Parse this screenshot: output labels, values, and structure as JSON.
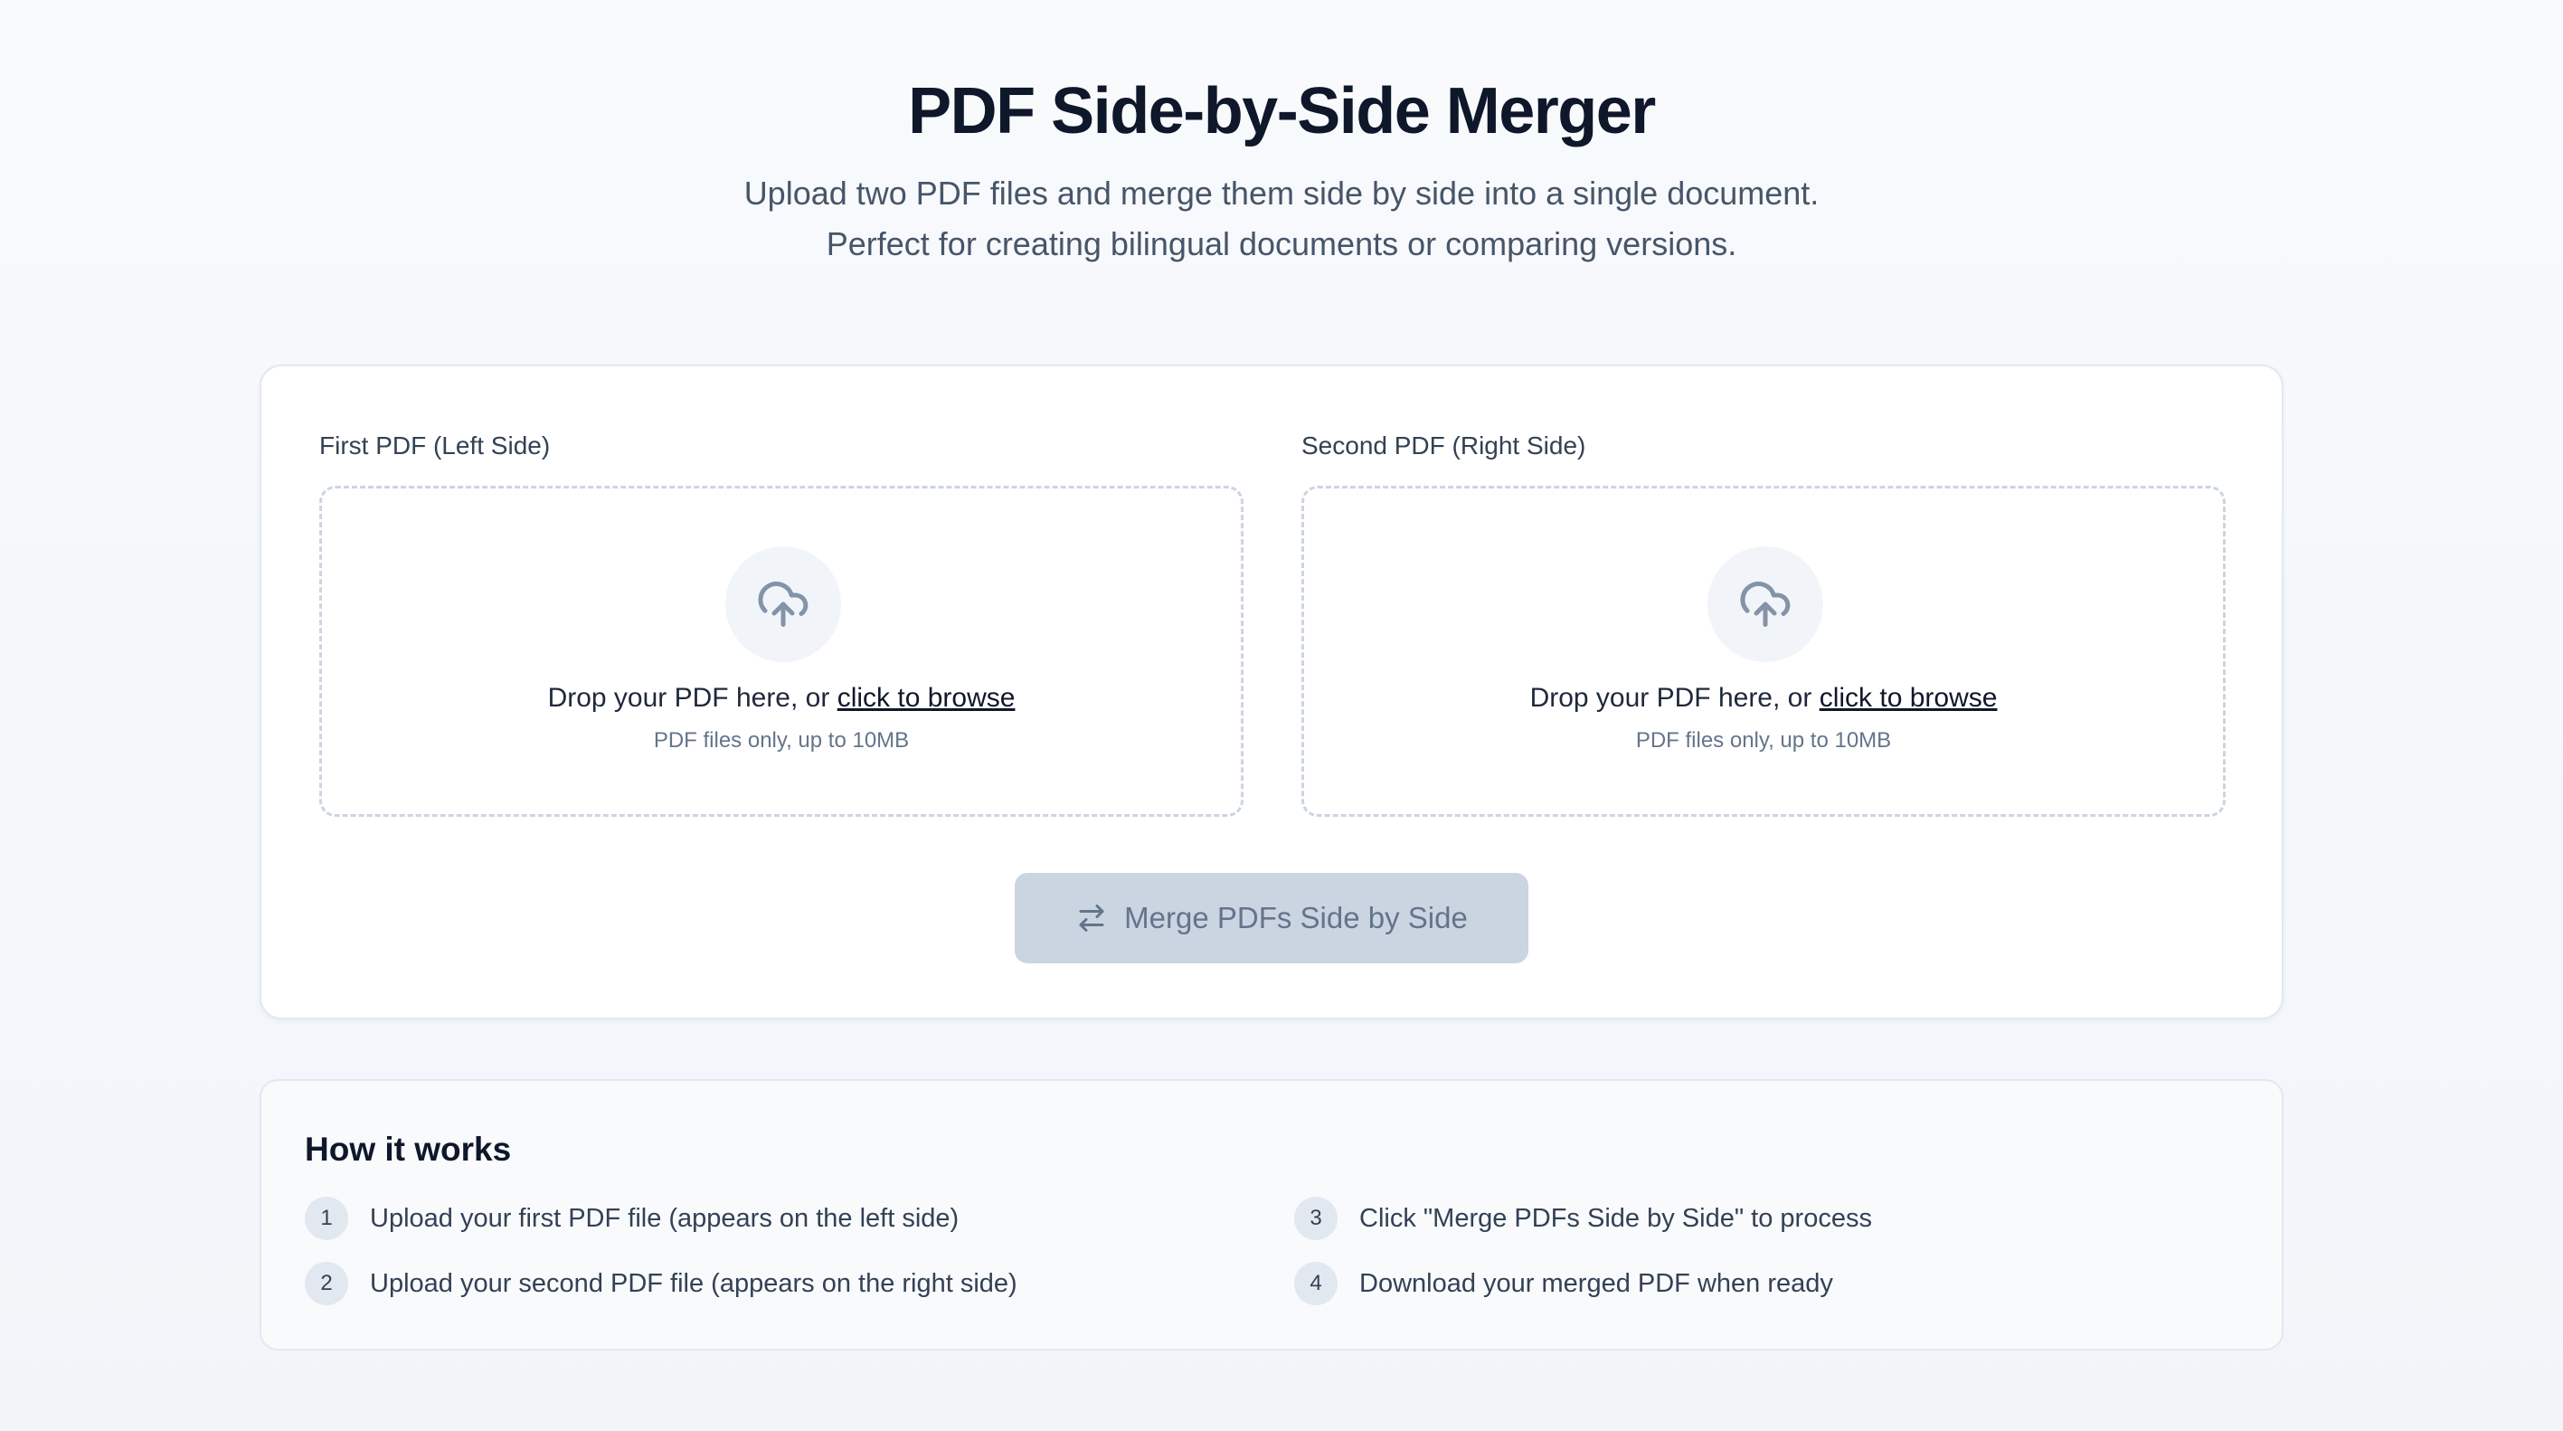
{
  "header": {
    "title": "PDF Side-by-Side Merger",
    "subtitle_line1": "Upload two PDF files and merge them side by side into a single document.",
    "subtitle_line2": "Perfect for creating bilingual documents or comparing versions."
  },
  "uploads": {
    "left": {
      "label": "First PDF (Left Side)",
      "drop_text": "Drop your PDF here, or ",
      "browse_text": "click to browse",
      "hint": "PDF files only, up to 10MB",
      "icon": "cloud-upload-icon"
    },
    "right": {
      "label": "Second PDF (Right Side)",
      "drop_text": "Drop your PDF here, or ",
      "browse_text": "click to browse",
      "hint": "PDF files only, up to 10MB",
      "icon": "cloud-upload-icon"
    }
  },
  "merge_button": {
    "label": "Merge PDFs Side by Side",
    "icon": "swap-arrows-icon",
    "disabled": true
  },
  "how_it_works": {
    "title": "How it works",
    "steps": [
      {
        "num": "1",
        "text": "Upload your first PDF file (appears on the left side)"
      },
      {
        "num": "2",
        "text": "Upload your second PDF file (appears on the right side)"
      },
      {
        "num": "3",
        "text": "Click \"Merge PDFs Side by Side\" to process"
      },
      {
        "num": "4",
        "text": "Download your merged PDF when ready"
      }
    ]
  },
  "colors": {
    "title": "#0f172a",
    "subtitle": "#475569",
    "button_disabled_bg": "#cbd5e1",
    "button_disabled_text": "#64748b",
    "dropzone_border": "#cbd5e1"
  }
}
